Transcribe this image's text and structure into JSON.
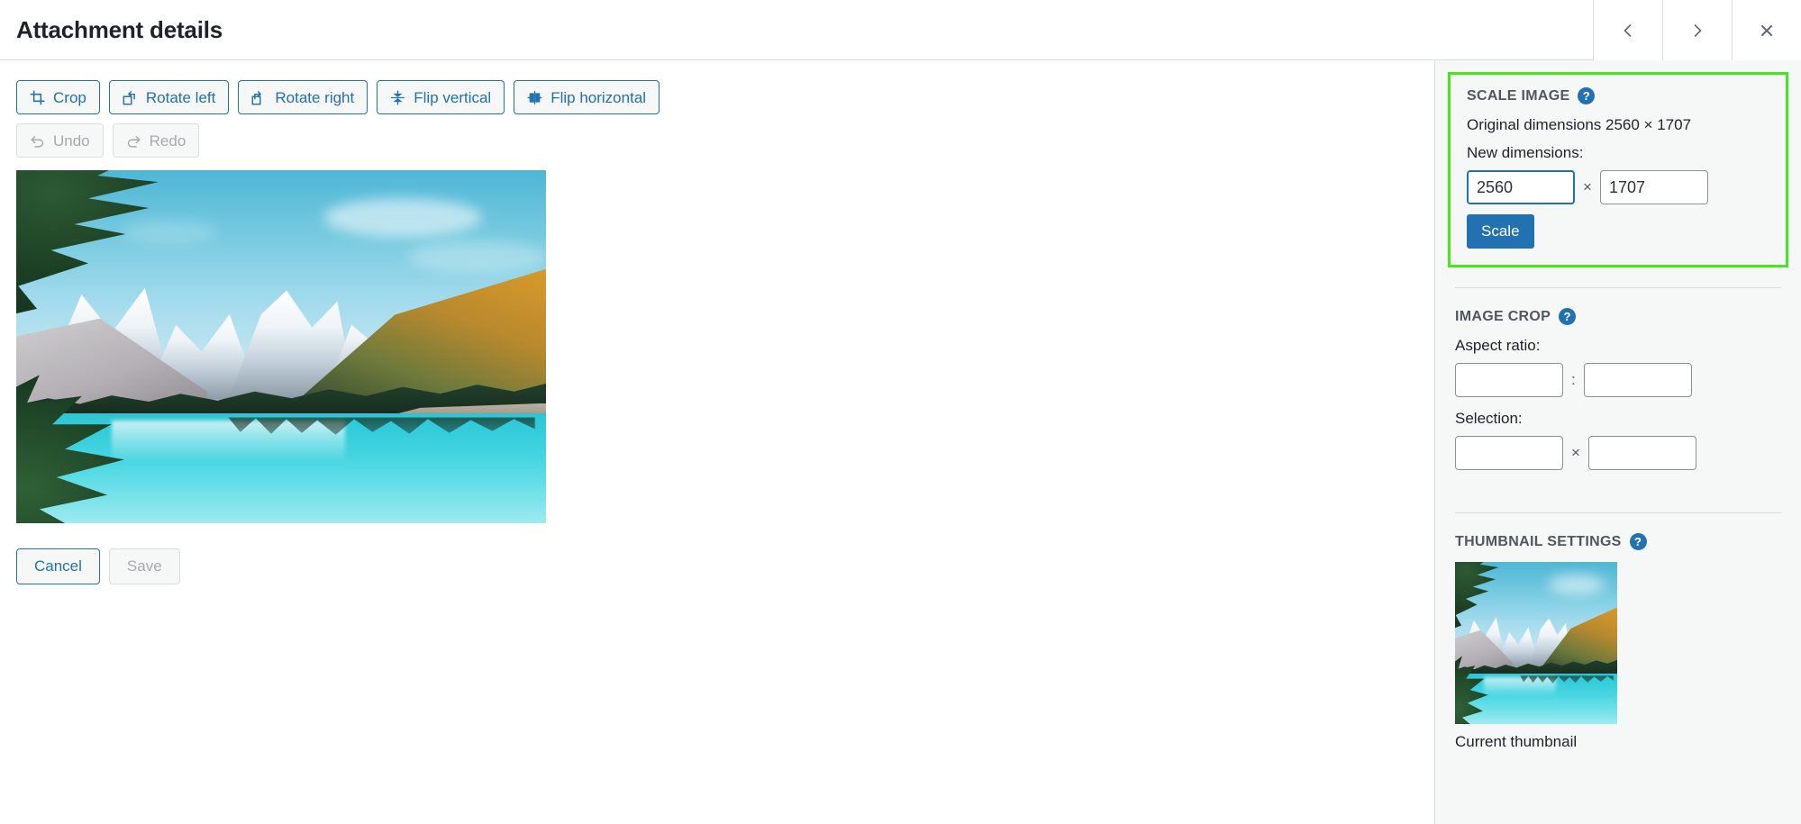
{
  "header": {
    "title": "Attachment details",
    "nav": {
      "previous_label": "‹",
      "next_label": "›",
      "close_label": "×"
    }
  },
  "toolbar": {
    "row1": [
      {
        "label": "Crop",
        "icon": "crop-icon",
        "disabled": false
      },
      {
        "label": "Rotate left",
        "icon": "rotate-left-icon",
        "disabled": false
      },
      {
        "label": "Rotate right",
        "icon": "rotate-right-icon",
        "disabled": false
      },
      {
        "label": "Flip vertical",
        "icon": "flip-vertical-icon",
        "disabled": false
      },
      {
        "label": "Flip horizontal",
        "icon": "flip-horizontal-icon",
        "disabled": false
      }
    ],
    "row2": [
      {
        "label": "Undo",
        "icon": "undo-icon",
        "disabled": true
      },
      {
        "label": "Redo",
        "icon": "redo-icon",
        "disabled": true
      }
    ]
  },
  "actions": {
    "cancel_label": "Cancel",
    "save_label": "Save"
  },
  "sidebar": {
    "scale_image": {
      "title": "SCALE IMAGE",
      "help_glyph": "?",
      "original_dimensions_text": "Original dimensions 2560 × 1707",
      "new_dimensions_label": "New dimensions:",
      "width_value": "2560",
      "height_value": "1707",
      "separator": "×",
      "scale_button_label": "Scale",
      "highlight_color": "#46e620"
    },
    "image_crop": {
      "title": "IMAGE CROP",
      "help_glyph": "?",
      "aspect_ratio_label": "Aspect ratio:",
      "aspect_ratio_width": "",
      "aspect_ratio_height": "",
      "aspect_separator": ":",
      "selection_label": "Selection:",
      "selection_width": "",
      "selection_height": "",
      "selection_separator": "×"
    },
    "thumbnail_settings": {
      "title": "THUMBNAIL SETTINGS",
      "help_glyph": "?",
      "current_thumbnail_caption": "Current thumbnail"
    }
  },
  "colors": {
    "accent_blue": "#2271b1",
    "sidebar_bg": "#f6f7f7",
    "border": "#dcdcde",
    "disabled_text": "#a7aaad",
    "title_text": "#1d2327"
  }
}
